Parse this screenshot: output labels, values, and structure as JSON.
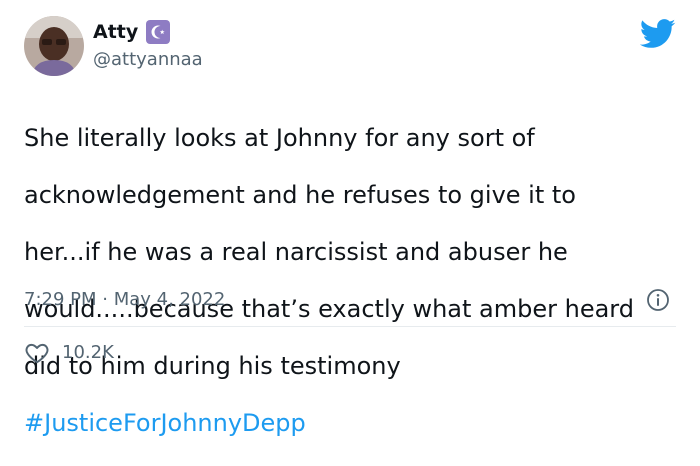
{
  "author": {
    "display_name": "Atty",
    "handle": "@attyannaa"
  },
  "tweet": {
    "lines": [
      "She literally looks at Johnny for any sort of",
      "acknowledgement and he refuses to give it to",
      "her...if he was a real narcissist and abuser he",
      "would.....because that’s exactly what amber heard",
      "did to him during his testimony"
    ],
    "hashtag": "#JusticeForJohnnyDepp"
  },
  "meta": {
    "timestamp": "7:29 PM · May 4, 2022"
  },
  "engagement": {
    "likes": "10.2K"
  },
  "colors": {
    "brand": "#1d9bf0",
    "secondary_text": "#536471",
    "badge": "#8e7cc3"
  },
  "icons": {
    "badge": "crescent-star-icon",
    "brand": "twitter-bird-icon",
    "info": "info-icon",
    "like": "heart-icon"
  }
}
